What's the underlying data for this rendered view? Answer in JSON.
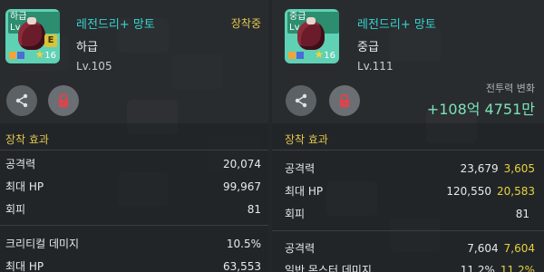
{
  "left": {
    "icon": {
      "grade_tag": "하급",
      "level_tag": "Lv.105",
      "badge": "E",
      "stars": "16"
    },
    "item_name": "레전드리+ 망토",
    "status": "장착중",
    "grade": "하급",
    "level": "Lv.105",
    "effects": {
      "title": "장착 효과",
      "stats": [
        {
          "label": "공격력",
          "value": "20,074"
        },
        {
          "label": "최대 HP",
          "value": "99,967"
        },
        {
          "label": "회피",
          "value": "81"
        },
        {
          "label": "크리티컬 데미지",
          "value": "10.5%"
        },
        {
          "label": "최대 HP",
          "value": "63,553"
        }
      ]
    }
  },
  "right": {
    "icon": {
      "grade_tag": "중급",
      "level_tag": "Lv.111",
      "stars": "16"
    },
    "item_name": "레전드리+ 망토",
    "grade": "중급",
    "level": "Lv.111",
    "power_change_label": "전투력 변화",
    "power_change_value": "+108억 4751만",
    "effects": {
      "title": "장착 효과",
      "stats": [
        {
          "label": "공격력",
          "value": "23,679",
          "diff": "3,605"
        },
        {
          "label": "최대 HP",
          "value": "120,550",
          "diff": "20,583"
        },
        {
          "label": "회피",
          "value": "81",
          "diff": ""
        },
        {
          "label": "공격력",
          "value": "7,604",
          "diff": "7,604"
        },
        {
          "label": "일반 몬스터 데미지",
          "value": "11.2%",
          "diff": "11.2%"
        }
      ]
    }
  },
  "colors": {
    "accent_teal": "#36d4d0",
    "accent_yellow": "#e0c64b",
    "power_green": "#7be3b6",
    "lock_red": "#e5414b"
  }
}
